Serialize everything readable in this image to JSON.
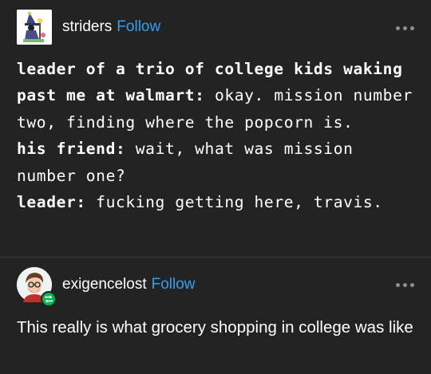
{
  "post1": {
    "username": "striders",
    "follow_label": "Follow",
    "lines": [
      {
        "speaker": "leader of a trio of college kids waking past me at walmart:",
        "text": " okay. mission number two, finding where the popcorn is."
      },
      {
        "speaker": "his friend:",
        "text": " wait, what was mission number one?"
      },
      {
        "speaker": "leader:",
        "text": " fucking getting here, travis."
      }
    ]
  },
  "post2": {
    "username": "exigencelost",
    "follow_label": "Follow",
    "text": "This really is what grocery shopping in college was like"
  },
  "icons": {
    "more": "more-options-icon",
    "reblog": "reblog-icon"
  },
  "colors": {
    "background": "#232323",
    "follow": "#32a0f0",
    "reblog_badge": "#00b84f"
  }
}
